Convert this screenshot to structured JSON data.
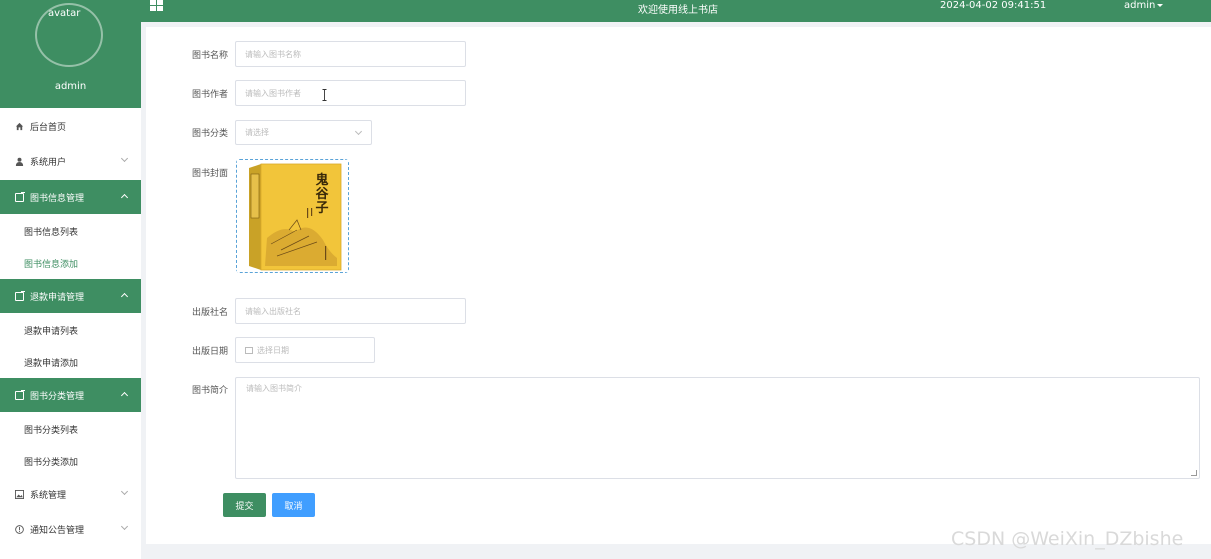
{
  "header": {
    "welcome": "欢迎使用线上书店",
    "datetime": "2024-04-02 09:41:51",
    "user": "admin"
  },
  "sidebar": {
    "avatar_alt": "avatar",
    "username": "admin",
    "items": [
      {
        "label": "后台首页"
      },
      {
        "label": "系统用户"
      },
      {
        "label": "图书信息管理"
      },
      {
        "label": "图书信息列表"
      },
      {
        "label": "图书信息添加"
      },
      {
        "label": "退款申请管理"
      },
      {
        "label": "退款申请列表"
      },
      {
        "label": "退款申请添加"
      },
      {
        "label": "图书分类管理"
      },
      {
        "label": "图书分类列表"
      },
      {
        "label": "图书分类添加"
      },
      {
        "label": "系统管理"
      },
      {
        "label": "通知公告管理"
      }
    ]
  },
  "form": {
    "name": {
      "label": "图书名称",
      "placeholder": "请输入图书名称"
    },
    "author": {
      "label": "图书作者",
      "placeholder": "请输入图书作者"
    },
    "category": {
      "label": "图书分类",
      "placeholder": "请选择"
    },
    "cover": {
      "label": "图书封面",
      "title": "鬼谷子"
    },
    "publisher": {
      "label": "出版社名",
      "placeholder": "请输入出版社名"
    },
    "date": {
      "label": "出版日期",
      "placeholder": "选择日期"
    },
    "intro": {
      "label": "图书简介",
      "placeholder": "请输入图书简介"
    },
    "submit": "提交",
    "cancel": "取消"
  },
  "watermark": "CSDN @WeiXin_DZbishe",
  "colors": {
    "primary": "#3e8e62",
    "blue": "#409eff"
  }
}
